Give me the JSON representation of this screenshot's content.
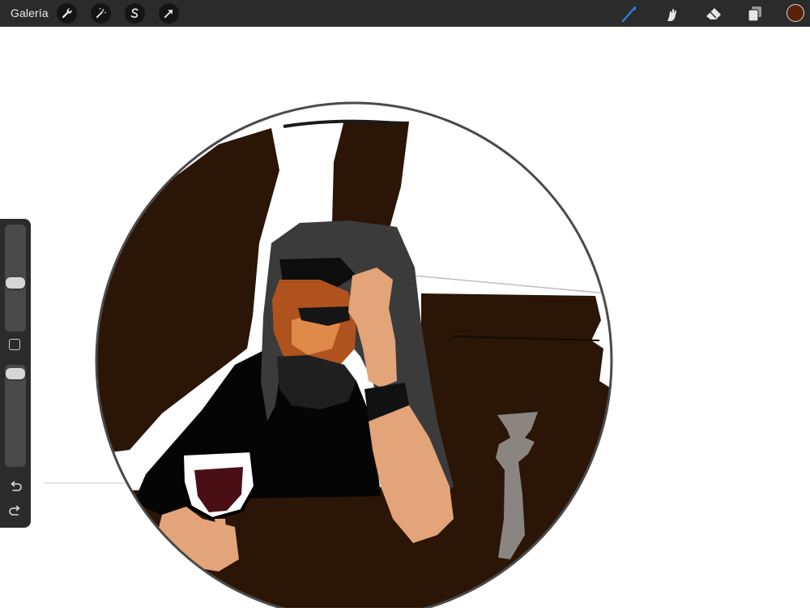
{
  "toolbar": {
    "gallery_label": "Galería",
    "left_tools": [
      {
        "name": "actions",
        "icon": "wrench-icon"
      },
      {
        "name": "adjustments",
        "icon": "magic-wand-icon"
      },
      {
        "name": "selection",
        "icon": "selection-s-icon"
      },
      {
        "name": "transform",
        "icon": "arrow-cursor-icon"
      }
    ],
    "right_tools": [
      {
        "name": "brush",
        "icon": "brush-icon",
        "active": true
      },
      {
        "name": "smudge",
        "icon": "smudge-finger-icon",
        "active": false
      },
      {
        "name": "eraser",
        "icon": "eraser-icon",
        "active": false
      },
      {
        "name": "layers",
        "icon": "layers-icon",
        "active": false
      }
    ],
    "active_color": "#5a2208"
  },
  "sidebar": {
    "brush_size_level": 0.45,
    "opacity_level": 0.0,
    "modify_icon": "square-icon",
    "undo_icon": "undo-icon",
    "redo_icon": "redo-icon"
  },
  "palette": {
    "dark_brown": "#2a1506",
    "black": "#050505",
    "skin": "#e3a47a",
    "gray_hair": "#3b3b3b",
    "stone": "#8a8580",
    "wine": "#4a0f14",
    "accent_blue": "#2f7fe0"
  }
}
